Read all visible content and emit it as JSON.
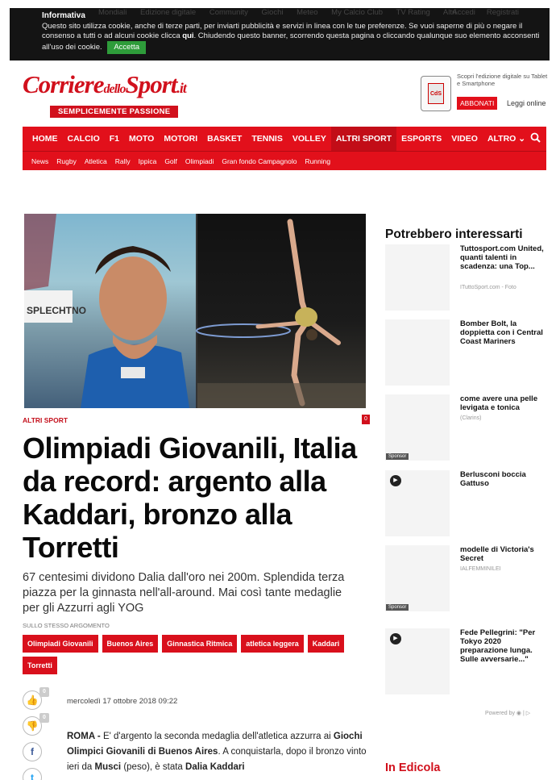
{
  "cookie": {
    "title": "Informativa",
    "text_before": "Questo sito utilizza cookie, anche di terze parti, per inviarti pubblicità e servizi in linea con le tue preferenze. Se vuoi saperne di più o negare il consenso a tutti o ad alcuni cookie clicca ",
    "link": "qui",
    "text_after": ". Chiudendo questo banner, scorrendo questa pagina o cliccando qualunque suo elemento acconsenti all'uso dei cookie.",
    "accept": "Accetta"
  },
  "ghost_nav": {
    "items": [
      "Mondiali",
      "Edizione digitale",
      "Community",
      "Giochi",
      "Meteo",
      "My Calcio Club",
      "TV Rating",
      "Altri"
    ],
    "right": [
      "Accedi",
      "Registrati"
    ]
  },
  "logo": {
    "name_a": "Corriere",
    "name_b": "dello",
    "name_c": "Sport",
    "tld": ".it",
    "slogan": "SEMPLICEMENTE PASSIONE"
  },
  "edition": {
    "promo": "Scopri l'edizione digitale su Tablet e Smartphone",
    "icon_text": "CdS",
    "subscribe": "ABBONATI",
    "read": "Leggi online"
  },
  "nav": {
    "items": [
      "HOME",
      "CALCIO",
      "F1",
      "MOTO",
      "MOTORI",
      "BASKET",
      "TENNIS",
      "VOLLEY",
      "ALTRI SPORT",
      "ESPORTS",
      "VIDEO",
      "ALTRO ⌄"
    ],
    "active_index": 8,
    "sub": [
      "News",
      "Rugby",
      "Atletica",
      "Rally",
      "Ippica",
      "Golf",
      "Olimpiadi",
      "Gran fondo Campagnolo",
      "Running"
    ]
  },
  "hero": {
    "bib_text": "SPLECHTNO"
  },
  "article": {
    "category": "ALTRI SPORT",
    "comments": "0",
    "title": "Olimpiadi Giovanili, Italia da record: argento alla Kaddari, bronzo alla Torretti",
    "subtitle": "67 centesimi dividono Dalia dall'oro nei 200m. Splendida terza piazza per la ginnasta nell'all-around. Mai così tante medaglie per gli Azzurri agli YOG",
    "same_topic": "SULLO STESSO ARGOMENTO",
    "tags": [
      "Olimpiadi Giovanili",
      "Buenos Aires",
      "Ginnastica Ritmica",
      "atletica leggera",
      "Kaddari",
      "Torretti"
    ],
    "date": "mercoledì 17 ottobre 2018 09:22",
    "body": {
      "p1": "ROMA - ",
      "p2": "E' d'argento la seconda medaglia dell'atletica azzurra ai ",
      "p3": "Giochi Olimpici Giovanili di Buenos Aires",
      "p4": ". A conquistarla, dopo il bronzo vinto ieri da ",
      "p5": "Musci",
      "p6": " (peso), è stata ",
      "p7": "Dalia Kaddari"
    },
    "social": {
      "likes": "0",
      "dislikes": "0"
    }
  },
  "sidebar": {
    "heading": "Potrebbero interessarti",
    "items": [
      {
        "title": "Tuttosport.com United, quanti talenti in scadenza: una Top...",
        "source": "ITuttoSport.com - Foto"
      },
      {
        "title": "Bomber Bolt, la doppietta con i Central Coast Mariners",
        "source": ""
      },
      {
        "title": "come avere una pelle levigata e tonica",
        "source": "(Clarins)"
      },
      {
        "title": "Berlusconi boccia Gattuso",
        "source": ""
      },
      {
        "title": "modelle di Victoria's Secret",
        "source": "IALFEMMINILEI"
      },
      {
        "title": "Fede Pellegrini: \"Per Tokyo 2020 preparazione lunga. Sulle avversarie...\"",
        "source": ""
      }
    ],
    "sponsor_label": "Sponsor",
    "powered_by": "Powered by",
    "edicola": "In Edicola"
  }
}
